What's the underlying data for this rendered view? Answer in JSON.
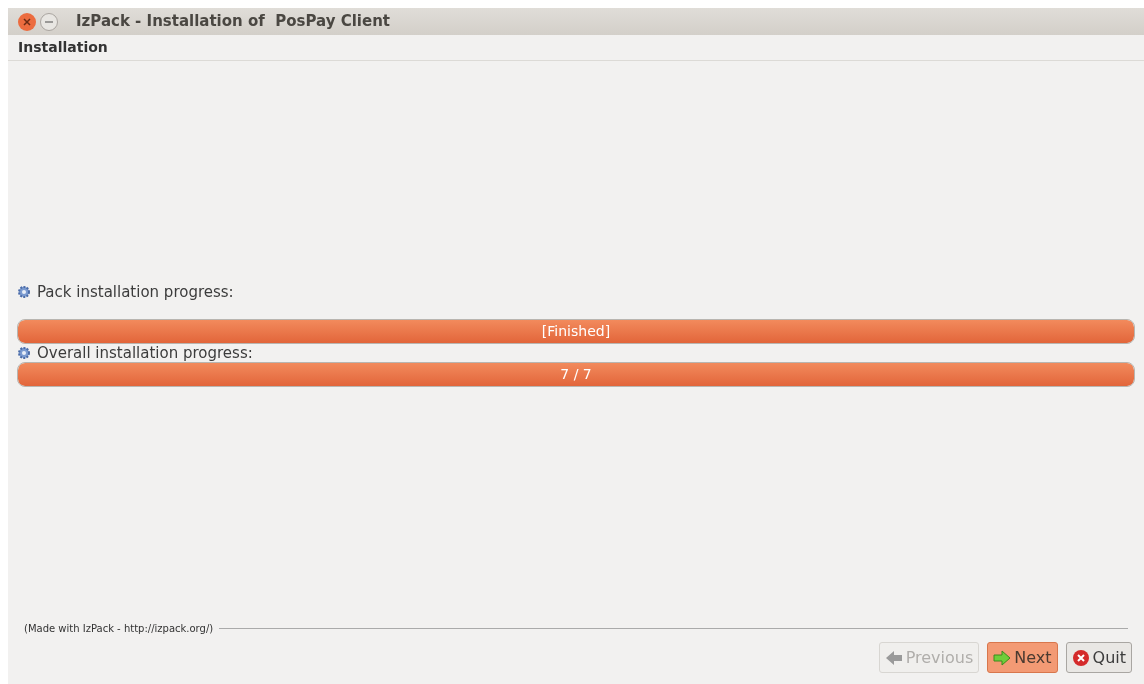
{
  "window": {
    "title": "IzPack - Installation of  PosPay Client"
  },
  "header": {
    "title": "Installation"
  },
  "progress": [
    {
      "label": "Pack installation progress:",
      "text": "[Finished]",
      "level": 1
    },
    {
      "label": "Overall installation progress:",
      "text": "7 / 7",
      "level": 1
    }
  ],
  "footer": {
    "credit": "(Made with IzPack - http://izpack.org/)"
  },
  "buttons": [
    {
      "kind": "previous",
      "label": "Previous",
      "disabled": true,
      "focused": false
    },
    {
      "kind": "next",
      "label": "Next",
      "disabled": false,
      "focused": true
    },
    {
      "kind": "quit",
      "label": "Quit",
      "disabled": false,
      "focused": false
    }
  ]
}
